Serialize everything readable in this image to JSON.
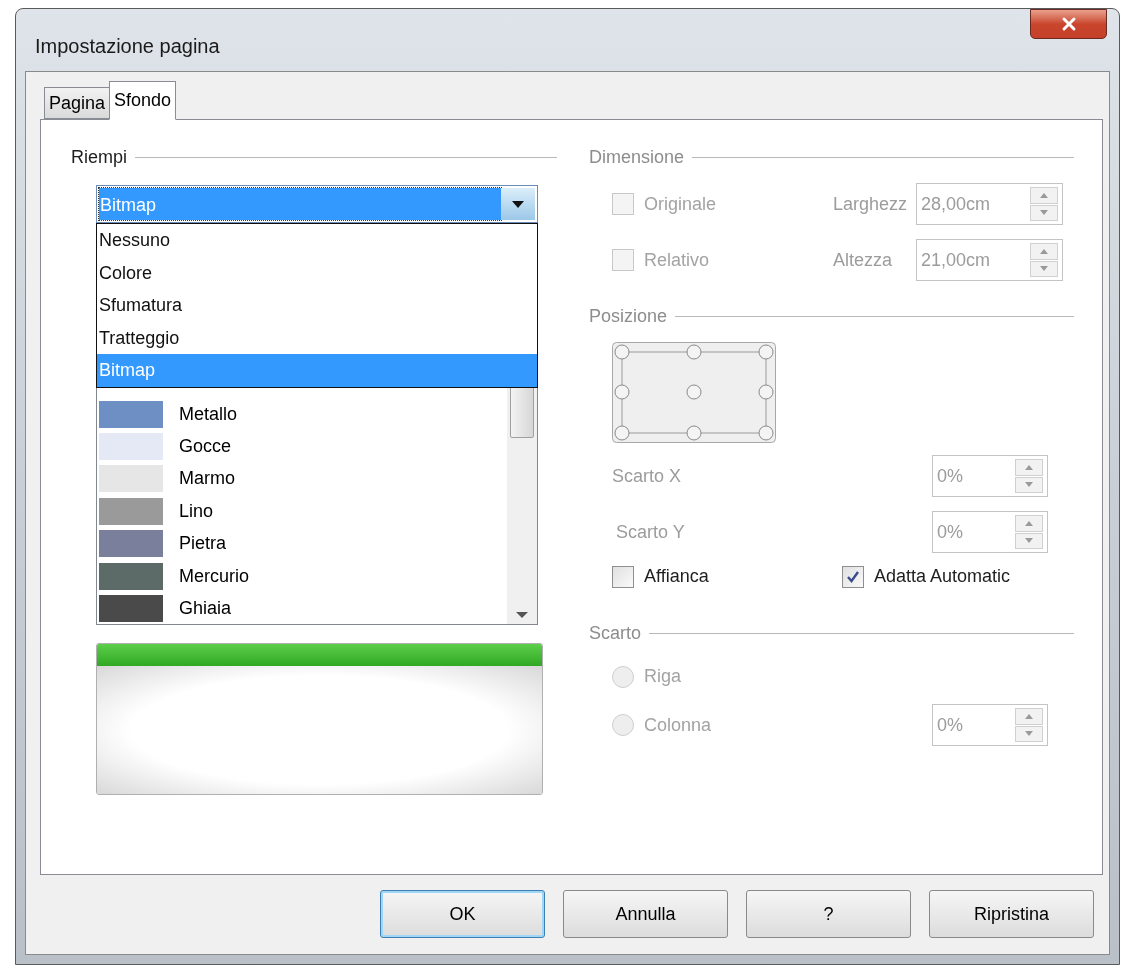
{
  "window": {
    "title": "Impostazione pagina"
  },
  "tabs": [
    {
      "label": "Pagina",
      "selected": false
    },
    {
      "label": "Sfondo",
      "selected": true
    }
  ],
  "fill": {
    "title": "Riempi",
    "dropdown": {
      "value": "Bitmap",
      "expanded": true,
      "options": [
        {
          "label": "Nessuno",
          "selected": false
        },
        {
          "label": "Colore",
          "selected": false
        },
        {
          "label": "Sfumatura",
          "selected": false
        },
        {
          "label": "Tratteggio",
          "selected": false
        },
        {
          "label": "Bitmap",
          "selected": true
        }
      ]
    },
    "bitmaps": [
      {
        "name": "Metallo",
        "color": "#6d8fc4"
      },
      {
        "name": "Gocce",
        "color": "#e4e9f5"
      },
      {
        "name": "Marmo",
        "color": "#e6e6e6"
      },
      {
        "name": "Lino",
        "color": "#9a9a9a"
      },
      {
        "name": "Pietra",
        "color": "#7a7f9c"
      },
      {
        "name": "Mercurio",
        "color": "#5d6b68"
      },
      {
        "name": "Ghiaia",
        "color": "#4a4a4a"
      }
    ]
  },
  "size": {
    "title": "Dimensione",
    "disabled": true,
    "original": {
      "label": "Originale",
      "checked": false
    },
    "relative": {
      "label": "Relativo",
      "checked": false
    },
    "width": {
      "label": "Larghezz",
      "value": "28,00cm"
    },
    "height": {
      "label": "Altezza",
      "value": "21,00cm"
    }
  },
  "position": {
    "title": "Posizione",
    "disabled": true,
    "offset_x": {
      "label": "Scarto X",
      "value": "0%"
    },
    "offset_y": {
      "label": "Scarto Y",
      "value": "0%"
    },
    "tile": {
      "label": "Affianca",
      "checked": false,
      "disabled": false
    },
    "autofit": {
      "label": "Adatta Automatic",
      "checked": true,
      "disabled": false
    }
  },
  "offset": {
    "title": "Scarto",
    "disabled": true,
    "row": {
      "label": "Riga",
      "selected": false
    },
    "column": {
      "label": "Colonna",
      "selected": false
    },
    "value": "0%"
  },
  "buttons": [
    {
      "label": "OK",
      "default": true
    },
    {
      "label": "Annulla",
      "default": false
    },
    {
      "label": "?",
      "default": false
    },
    {
      "label": "Ripristina",
      "default": false
    }
  ]
}
